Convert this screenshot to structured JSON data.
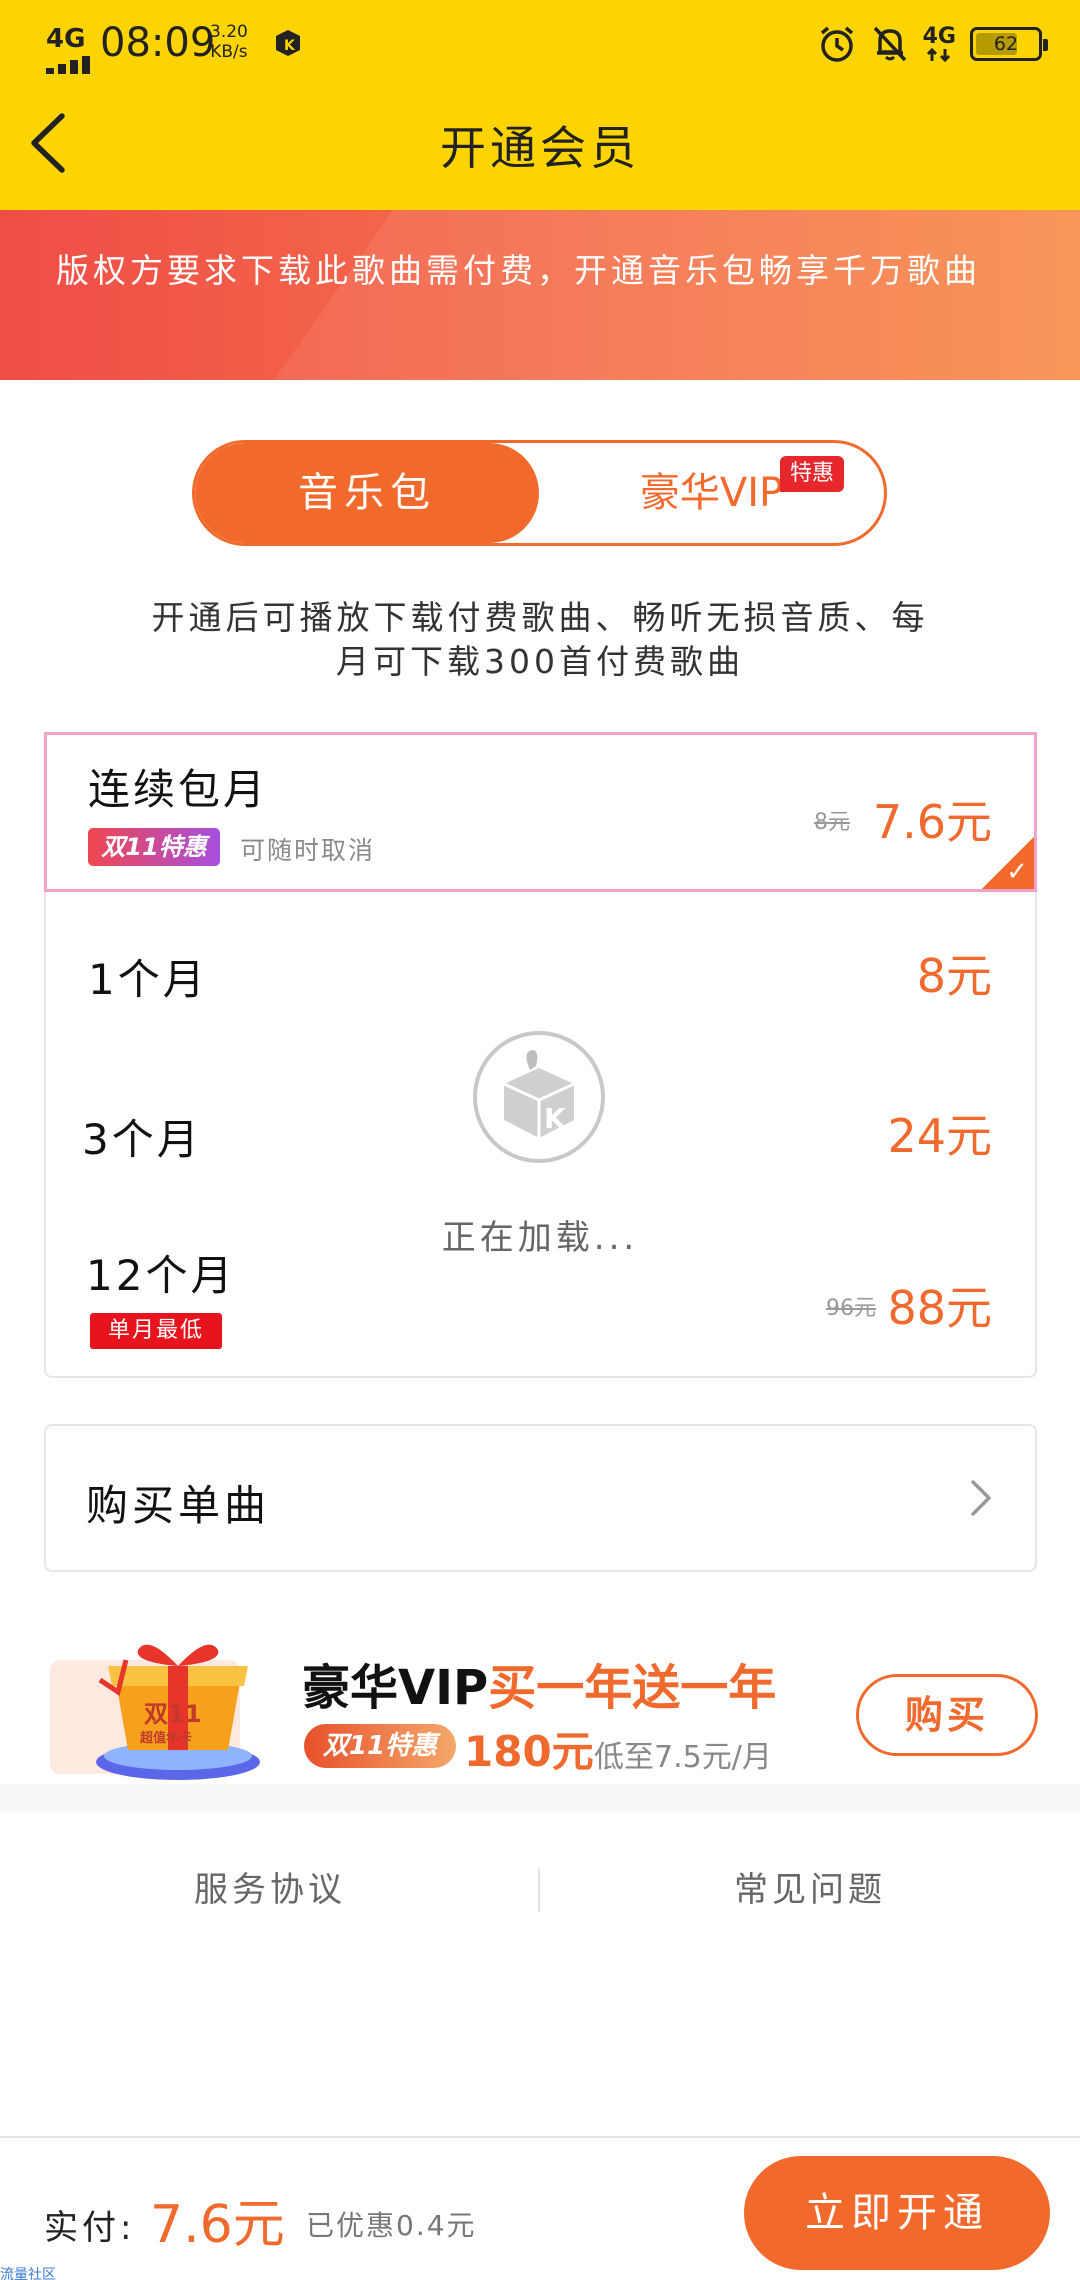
{
  "status_bar": {
    "network": "4G",
    "time": "08:09",
    "speed_value": "3.20",
    "speed_unit": "KB/s",
    "network_right": "4G",
    "battery": "62"
  },
  "header": {
    "title": "开通会员"
  },
  "banner": {
    "text": "版权方要求下载此歌曲需付费，开通音乐包畅享千万歌曲"
  },
  "tabs": [
    {
      "label": "音乐包",
      "selected": true
    },
    {
      "label": "豪华VIP",
      "selected": false
    }
  ],
  "tab_badge": "特惠",
  "description": "开通后可播放下载付费歌曲、畅听无损音质、每月可下载300首付费歌曲",
  "plans": [
    {
      "name": "连续包月",
      "price": "7.6元",
      "original": "8元",
      "tag": "双11特惠",
      "note": "可随时取消",
      "selected": true
    },
    {
      "name": "1个月",
      "price": "8元"
    },
    {
      "name": "3个月",
      "price": "24元"
    },
    {
      "name": "12个月",
      "price": "88元",
      "original": "96元",
      "tag": "单月最低"
    }
  ],
  "loading": {
    "text": "正在加载..."
  },
  "single_song": {
    "label": "购买单曲"
  },
  "promo": {
    "title_main": "豪华VIP",
    "title_highlight": "买一年送一年",
    "tag": "双11特惠",
    "price": "180元",
    "sub": "低至7.5元/月",
    "button": "购买",
    "gift_text": "双11",
    "gift_sub": "超值年卡"
  },
  "links": {
    "agreement": "服务协议",
    "faq": "常见问题"
  },
  "footer": {
    "pay_label": "实付:",
    "amount": "7.6元",
    "saved": "已优惠0.4元",
    "button": "立即开通"
  },
  "watermark": "流量社区",
  "colors": {
    "header": "#fdd400",
    "accent": "#f26a2b",
    "price": "#ef6a2c"
  }
}
